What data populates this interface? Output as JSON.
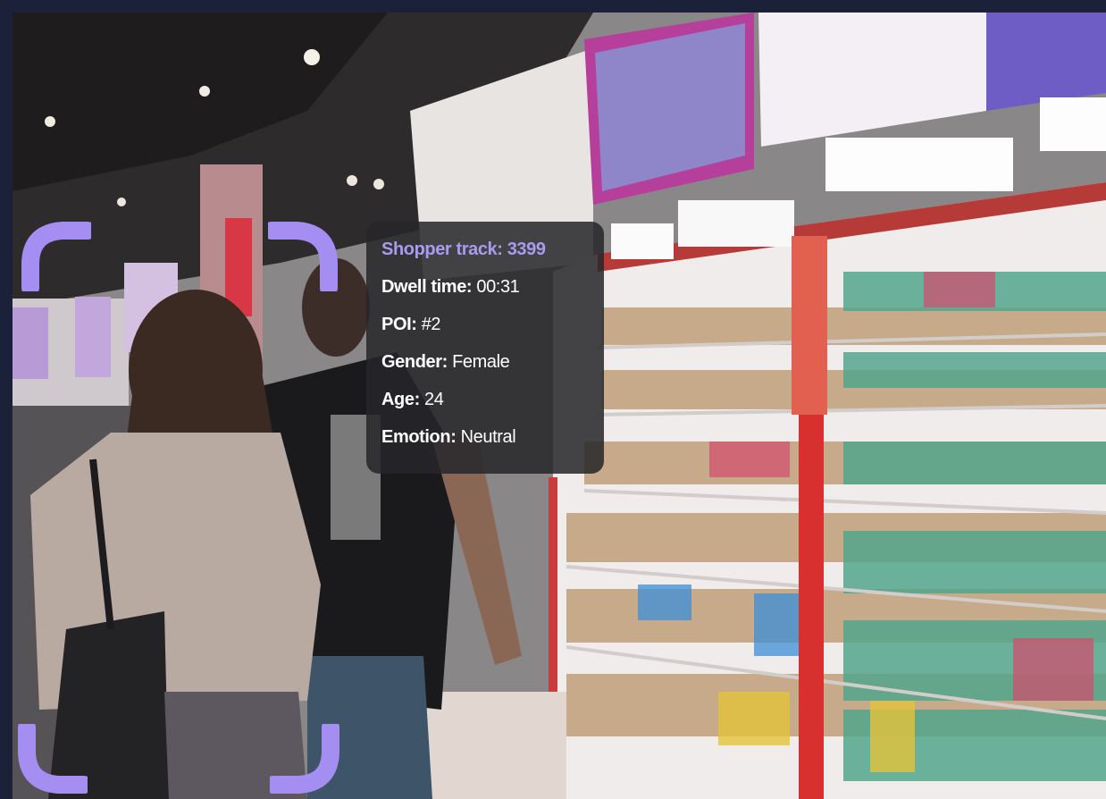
{
  "overlay": {
    "shopper_track": "Shopper track: 3399",
    "dwell": {
      "label": "Dwell time:",
      "value": "00:31"
    },
    "poi": {
      "label": "POI:",
      "value": "#2"
    },
    "gender": {
      "label": "Gender:",
      "value": "Female"
    },
    "age": {
      "label": "Age:",
      "value": "24"
    },
    "emotion": {
      "label": "Emotion:",
      "value": "Neutral"
    }
  },
  "colors": {
    "bracket": "#a48ef2",
    "track_title": "#a99bf0",
    "panel_bg": "#26262a",
    "page_bg": "#1b2138"
  },
  "icons": {
    "corner_brackets": "face-tracking-bracket"
  }
}
